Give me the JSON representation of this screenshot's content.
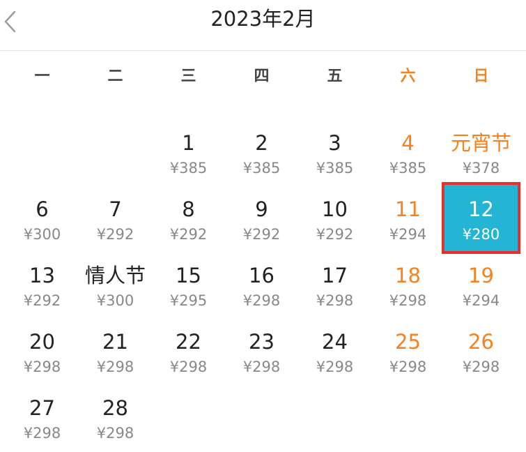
{
  "header": {
    "title": "2023年2月",
    "back_icon": "chevron-left-icon"
  },
  "weekdays": [
    "一",
    "二",
    "三",
    "四",
    "五",
    "六",
    "日"
  ],
  "colors": {
    "weekend": "#f5821f",
    "selected_bg": "#24b4d4",
    "selected_border": "#e8302a",
    "price": "#888888"
  },
  "days": [
    {
      "label": "1",
      "price": "¥385",
      "row": 0,
      "col": 2,
      "weekend": false,
      "selected": false
    },
    {
      "label": "2",
      "price": "¥385",
      "row": 0,
      "col": 3,
      "weekend": false,
      "selected": false
    },
    {
      "label": "3",
      "price": "¥385",
      "row": 0,
      "col": 4,
      "weekend": false,
      "selected": false
    },
    {
      "label": "4",
      "price": "¥385",
      "row": 0,
      "col": 5,
      "weekend": true,
      "selected": false
    },
    {
      "label": "元宵节",
      "price": "¥378",
      "row": 0,
      "col": 6,
      "weekend": true,
      "selected": false
    },
    {
      "label": "6",
      "price": "¥300",
      "row": 1,
      "col": 0,
      "weekend": false,
      "selected": false
    },
    {
      "label": "7",
      "price": "¥292",
      "row": 1,
      "col": 1,
      "weekend": false,
      "selected": false
    },
    {
      "label": "8",
      "price": "¥292",
      "row": 1,
      "col": 2,
      "weekend": false,
      "selected": false
    },
    {
      "label": "9",
      "price": "¥292",
      "row": 1,
      "col": 3,
      "weekend": false,
      "selected": false
    },
    {
      "label": "10",
      "price": "¥292",
      "row": 1,
      "col": 4,
      "weekend": false,
      "selected": false
    },
    {
      "label": "11",
      "price": "¥294",
      "row": 1,
      "col": 5,
      "weekend": true,
      "selected": false
    },
    {
      "label": "12",
      "price": "¥280",
      "row": 1,
      "col": 6,
      "weekend": true,
      "selected": true
    },
    {
      "label": "13",
      "price": "¥292",
      "row": 2,
      "col": 0,
      "weekend": false,
      "selected": false
    },
    {
      "label": "情人节",
      "price": "¥300",
      "row": 2,
      "col": 1,
      "weekend": false,
      "selected": false
    },
    {
      "label": "15",
      "price": "¥295",
      "row": 2,
      "col": 2,
      "weekend": false,
      "selected": false
    },
    {
      "label": "16",
      "price": "¥298",
      "row": 2,
      "col": 3,
      "weekend": false,
      "selected": false
    },
    {
      "label": "17",
      "price": "¥298",
      "row": 2,
      "col": 4,
      "weekend": false,
      "selected": false
    },
    {
      "label": "18",
      "price": "¥298",
      "row": 2,
      "col": 5,
      "weekend": true,
      "selected": false
    },
    {
      "label": "19",
      "price": "¥294",
      "row": 2,
      "col": 6,
      "weekend": true,
      "selected": false
    },
    {
      "label": "20",
      "price": "¥298",
      "row": 3,
      "col": 0,
      "weekend": false,
      "selected": false
    },
    {
      "label": "21",
      "price": "¥298",
      "row": 3,
      "col": 1,
      "weekend": false,
      "selected": false
    },
    {
      "label": "22",
      "price": "¥298",
      "row": 3,
      "col": 2,
      "weekend": false,
      "selected": false
    },
    {
      "label": "23",
      "price": "¥298",
      "row": 3,
      "col": 3,
      "weekend": false,
      "selected": false
    },
    {
      "label": "24",
      "price": "¥298",
      "row": 3,
      "col": 4,
      "weekend": false,
      "selected": false
    },
    {
      "label": "25",
      "price": "¥298",
      "row": 3,
      "col": 5,
      "weekend": true,
      "selected": false
    },
    {
      "label": "26",
      "price": "¥298",
      "row": 3,
      "col": 6,
      "weekend": true,
      "selected": false
    },
    {
      "label": "27",
      "price": "¥298",
      "row": 4,
      "col": 0,
      "weekend": false,
      "selected": false
    },
    {
      "label": "28",
      "price": "¥298",
      "row": 4,
      "col": 1,
      "weekend": false,
      "selected": false
    }
  ]
}
